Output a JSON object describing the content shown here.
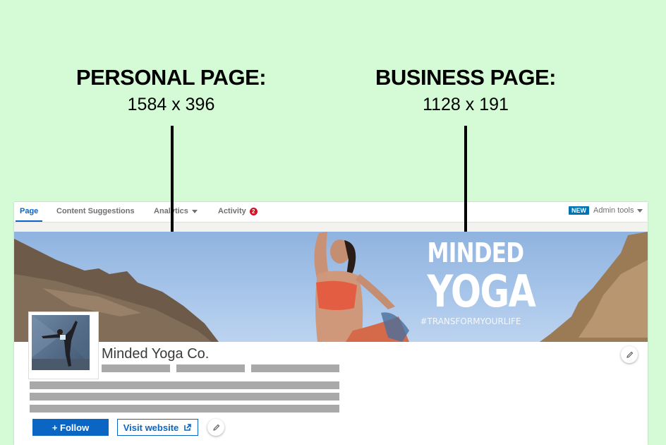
{
  "labels": {
    "personal": {
      "heading": "PERSONAL PAGE:",
      "dimensions": "1584 x 396"
    },
    "business": {
      "heading": "BUSINESS PAGE:",
      "dimensions": "1128 x 191"
    }
  },
  "nav": {
    "tabs": [
      {
        "label": "Page",
        "active": true
      },
      {
        "label": "Content Suggestions",
        "active": false
      },
      {
        "label": "Analytics",
        "active": false,
        "dropdown": true
      },
      {
        "label": "Activity",
        "active": false,
        "badge": "2"
      }
    ],
    "new_badge": "NEW",
    "admin_tools": "Admin tools"
  },
  "banner": {
    "line1": "MINDED",
    "line2": "YOGA",
    "hashtag": "#TRANSFORMYOURLIFE"
  },
  "company": {
    "name": "Minded Yoga Co."
  },
  "actions": {
    "follow": "+ Follow",
    "visit_website": "Visit website"
  },
  "icons": {
    "edit": "pencil-icon",
    "external_link": "external-link-icon",
    "dropdown": "caret-down-icon"
  },
  "colors": {
    "background": "#d4fbd6",
    "linkedin_blue": "#0a66c2",
    "notification_red": "#d11124",
    "placeholder_gray": "#a9a9a9"
  }
}
